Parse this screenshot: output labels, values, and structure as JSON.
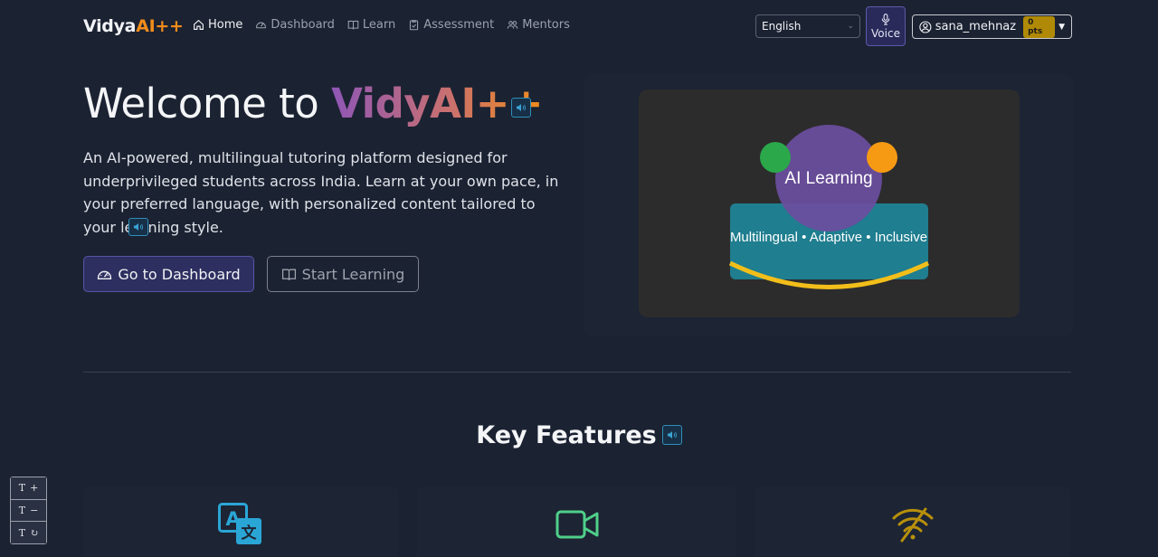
{
  "brand": {
    "part1": "Vidya",
    "part2": "AI++"
  },
  "nav": [
    {
      "label": "Home",
      "icon": "home-icon",
      "active": true
    },
    {
      "label": "Dashboard",
      "icon": "speedometer-icon",
      "active": false
    },
    {
      "label": "Learn",
      "icon": "book-icon",
      "active": false
    },
    {
      "label": "Assessment",
      "icon": "clipboard-check-icon",
      "active": false
    },
    {
      "label": "Mentors",
      "icon": "people-icon",
      "active": false
    }
  ],
  "language": {
    "selected": "English"
  },
  "voice": {
    "label": "Voice",
    "icon": "microphone-icon"
  },
  "user": {
    "name": "sana_mehnaz",
    "points": "0 pts"
  },
  "hero": {
    "title_prefix": "Welcome to ",
    "title_brand": "VidyAI++",
    "description": "An AI-powered, multilingual tutoring platform designed for underprivileged students across India. Learn at your own pace, in your preferred language, with personalized content tailored to your learning style.",
    "primary_button": "Go to Dashboard",
    "secondary_button": "Start Learning"
  },
  "illustration": {
    "title": "AI Learning",
    "subtitle": "Multilingual • Adaptive • Inclusive",
    "colors": {
      "background": "#2c2c2c",
      "purple": "#6b4d9e",
      "teal": "#1f7e8f",
      "green": "#2aa84a",
      "orange": "#f79a13",
      "yellow": "#f2be1a"
    }
  },
  "features": {
    "title": "Key Features",
    "cards": [
      {
        "icon": "translate-icon",
        "color": "#2aa6d6"
      },
      {
        "icon": "camera-video-icon",
        "color": "#4fd08a"
      },
      {
        "icon": "wifi-off-icon",
        "color": "#b8900c"
      }
    ]
  },
  "font_controls": [
    {
      "label": "T",
      "symbol": "+",
      "action": "increase"
    },
    {
      "label": "T",
      "symbol": "−",
      "action": "decrease"
    },
    {
      "label": "T",
      "symbol": "↻",
      "action": "reset"
    }
  ],
  "colors": {
    "background": "#1b2232",
    "accent_orange": "#f08c1a",
    "accent_purple": "#8e56b6",
    "primary_button_bg": "#2d2f60"
  }
}
